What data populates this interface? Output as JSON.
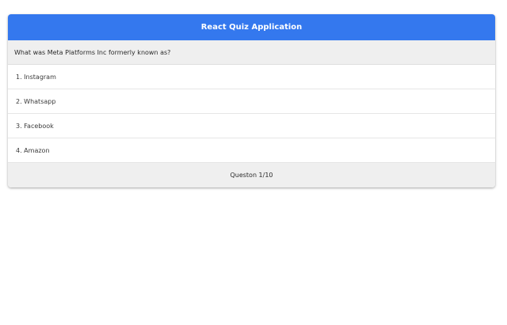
{
  "header": {
    "title": "React Quiz Application",
    "color": "#3478ee"
  },
  "question": {
    "text": "What was Meta Platforms Inc formerly known as?"
  },
  "options": [
    {
      "label": "1. Instagram"
    },
    {
      "label": "2. Whatsapp"
    },
    {
      "label": "3. Facebook"
    },
    {
      "label": "4. Amazon"
    }
  ],
  "footer": {
    "progress_text": "Queston 1/10"
  }
}
